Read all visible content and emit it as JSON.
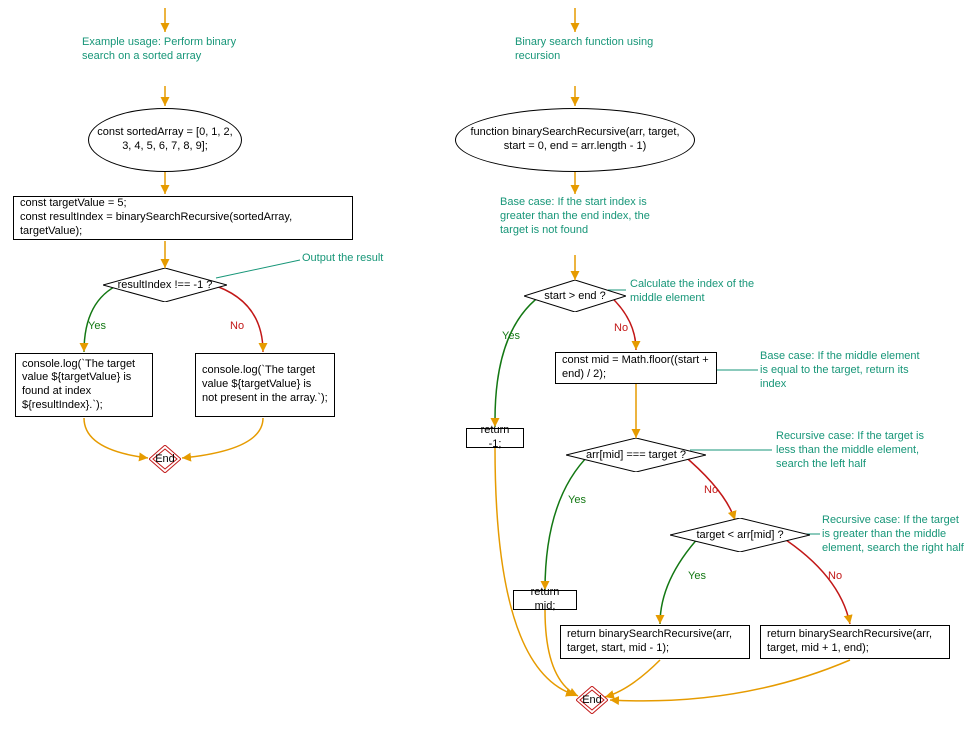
{
  "left": {
    "comment_start": "Example usage: Perform binary search on a sorted array",
    "init_array": "const sortedArray = [0, 1, 2, 3, 4, 5, 6, 7, 8, 9];",
    "setup": "const targetValue = 5;\nconst resultIndex = binarySearchRecursive(sortedArray, targetValue);",
    "comment_decision": "Output the result",
    "decision": "resultIndex !== -1 ?",
    "yes_box": "console.log(`The target value ${targetValue} is found at index ${resultIndex}.`);",
    "no_box": "console.log(`The target value ${targetValue} is not present in the array.`);",
    "end": "End"
  },
  "right": {
    "comment_start": "Binary search function using recursion",
    "func_header": "function binarySearchRecursive(arr, target, start = 0, end = arr.length - 1)",
    "comment_base1": "Base case: If the start index is greater than the end index, the target is not found",
    "decision1": "start > end ?",
    "comment_mid": "Calculate the index of the middle element",
    "mid_box": "const mid = Math.floor((start + end) / 2);",
    "ret_neg1": "return -1;",
    "comment_base2": "Base case: If the middle element is equal to the target, return its index",
    "decision2": "arr[mid] === target ?",
    "comment_rec_left": "Recursive case: If the target is less than the middle element, search the left half",
    "decision3": "target < arr[mid] ?",
    "comment_rec_right": "Recursive case: If the target is greater than the middle element, search the right half",
    "ret_mid": "return mid;",
    "ret_left": "return binarySearchRecursive(arr, target, start, mid - 1);",
    "ret_right": "return binarySearchRecursive(arr, target, mid + 1, end);",
    "end": "End"
  },
  "labels": {
    "yes": "Yes",
    "no": "No"
  }
}
